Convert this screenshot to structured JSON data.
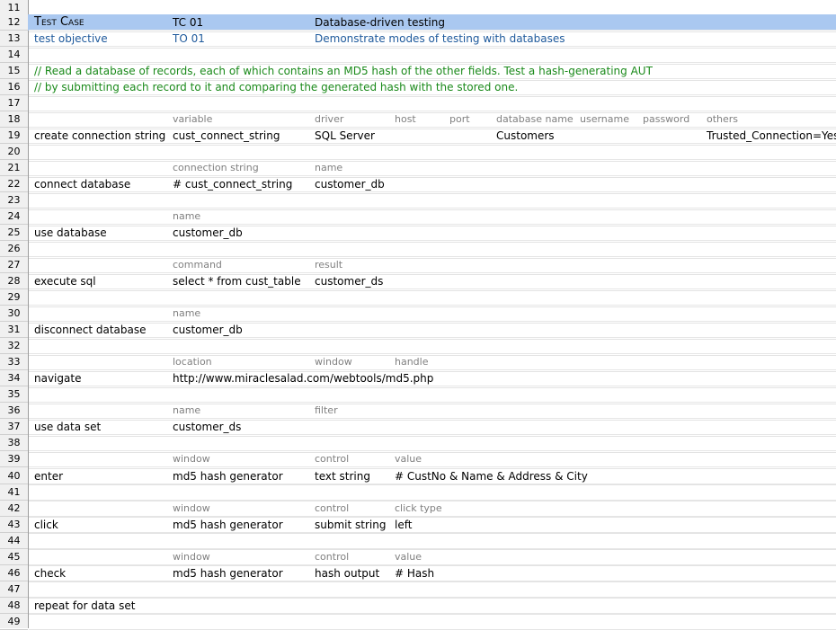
{
  "spreadsheet": {
    "row_numbers": [
      "11",
      "12",
      "13",
      "14",
      "15",
      "16",
      "17",
      "18",
      "19",
      "20",
      "21",
      "22",
      "23",
      "24",
      "25",
      "26",
      "27",
      "28",
      "29",
      "30",
      "31",
      "32",
      "33",
      "34",
      "35",
      "36",
      "37",
      "38",
      "39",
      "40",
      "41",
      "42",
      "43",
      "44",
      "45",
      "46",
      "47",
      "48",
      "49"
    ],
    "test_case": {
      "label": "Test Case",
      "id": "TC 01",
      "title": "Database-driven testing"
    },
    "test_objective": {
      "label": "test objective",
      "id": "TO 01",
      "text": "Demonstrate modes of testing with databases"
    },
    "comments": [
      "// Read a database of records, each of which contains an MD5 hash of the other fields. Test a hash-generating AUT",
      "// by submitting each record to it and comparing the generated hash with the stored one."
    ],
    "actions": [
      {
        "headers": [
          "variable",
          "driver",
          "host",
          "port",
          "database name",
          "username",
          "password",
          "others"
        ],
        "action": "create connection string",
        "values": [
          "cust_connect_string",
          "SQL Server",
          "",
          "",
          "Customers",
          "",
          "",
          "Trusted_Connection=Yes"
        ]
      },
      {
        "headers": [
          "connection string",
          "name"
        ],
        "action": "connect database",
        "values": [
          "# cust_connect_string",
          "customer_db"
        ]
      },
      {
        "headers": [
          "name"
        ],
        "action": "use database",
        "values": [
          "customer_db"
        ]
      },
      {
        "headers": [
          "command",
          "result"
        ],
        "action": "execute sql",
        "values": [
          "select * from cust_table",
          "customer_ds"
        ]
      },
      {
        "headers": [
          "name"
        ],
        "action": "disconnect database",
        "values": [
          "customer_db"
        ]
      },
      {
        "headers": [
          "location",
          "window",
          "handle"
        ],
        "action": "navigate",
        "values": [
          "http://www.miraclesalad.com/webtools/md5.php"
        ]
      },
      {
        "headers": [
          "name",
          "filter"
        ],
        "action": "use data set",
        "values": [
          "customer_ds"
        ]
      },
      {
        "headers": [
          "window",
          "control",
          "value"
        ],
        "action": "enter",
        "values": [
          "md5 hash generator",
          "text string",
          "# CustNo & Name & Address & City"
        ]
      },
      {
        "headers": [
          "window",
          "control",
          "click type"
        ],
        "action": "click",
        "values": [
          "md5 hash generator",
          "submit string",
          "left"
        ]
      },
      {
        "headers": [
          "window",
          "control",
          "value"
        ],
        "action": "check",
        "values": [
          "md5 hash generator",
          "hash output",
          "# Hash"
        ]
      }
    ],
    "repeat": "repeat for data set",
    "colors": {
      "selected_row": "#aac8f0",
      "comment": "#1a8a1a",
      "objective": "#1f5a9c",
      "header": "#808080"
    }
  }
}
